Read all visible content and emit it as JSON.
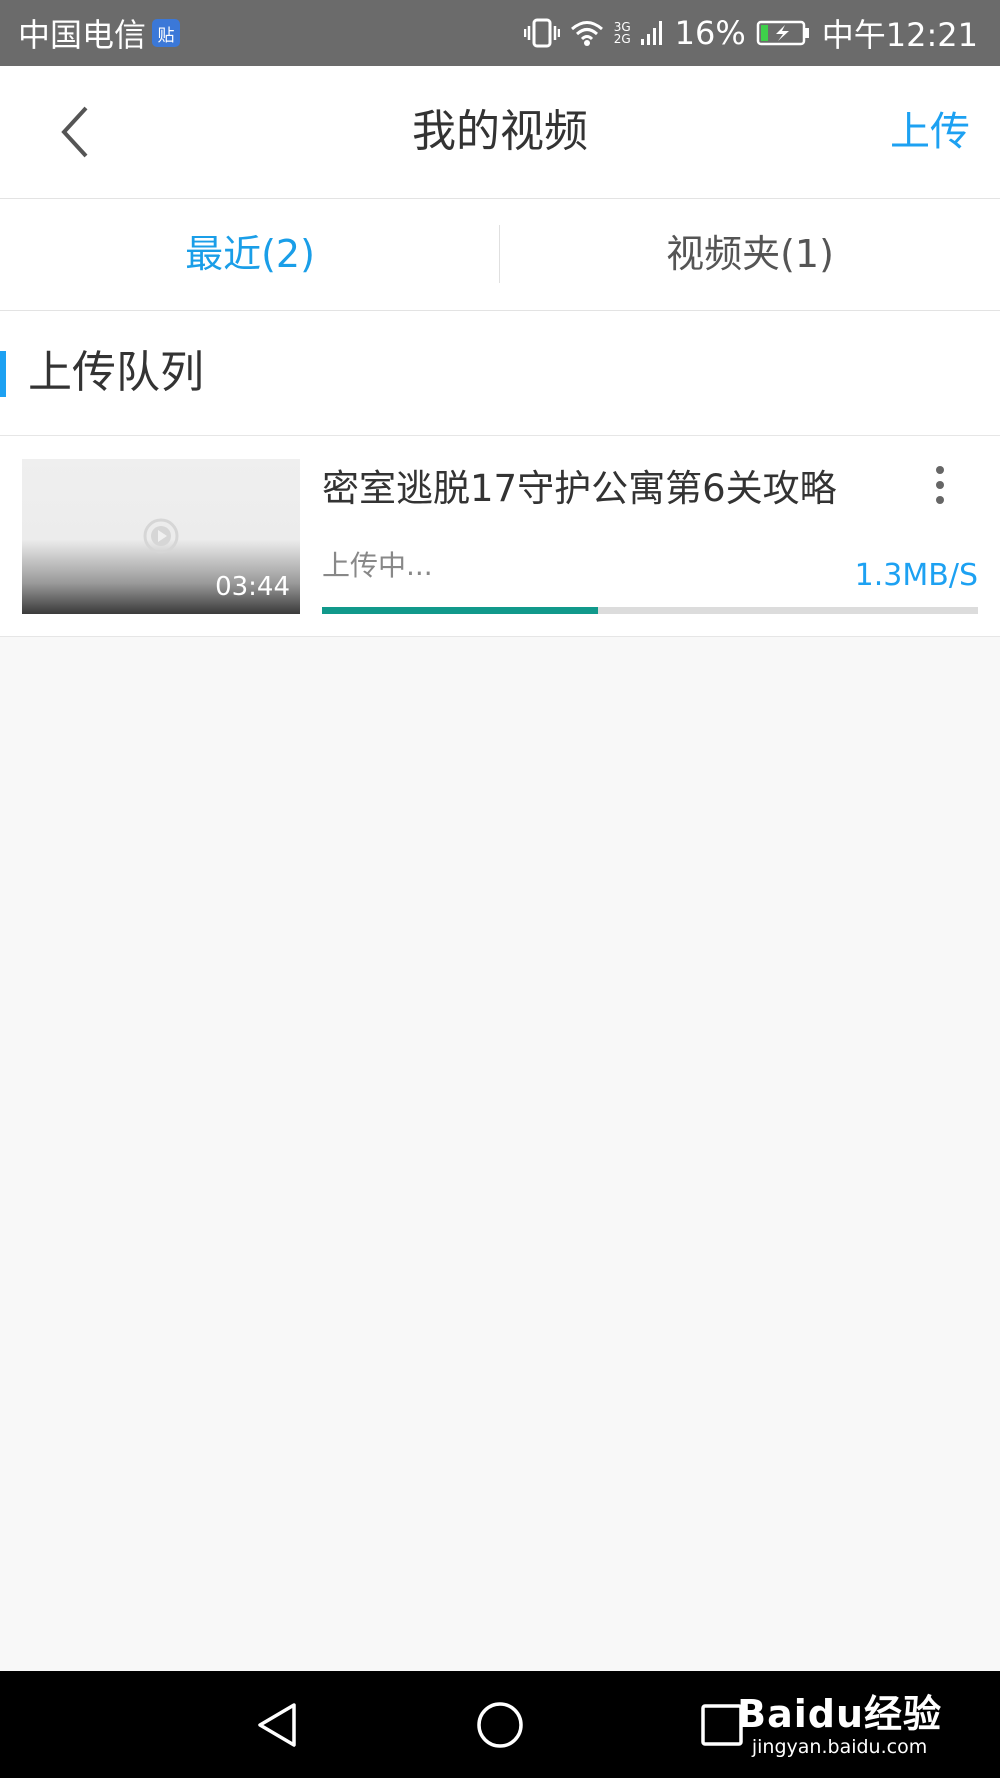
{
  "status_bar": {
    "carrier": "中国电信",
    "tieba_badge": "贴",
    "network_top": "3G",
    "network_bottom": "2G",
    "battery": "16%",
    "time": "中午12:21"
  },
  "header": {
    "title": "我的视频",
    "upload_label": "上传",
    "back_icon": "chevron-left-icon"
  },
  "tabs": [
    {
      "label": "最近(2)",
      "active": true
    },
    {
      "label": "视频夹(1)",
      "active": false
    }
  ],
  "section": {
    "title": "上传队列"
  },
  "upload_item": {
    "title": "密室逃脱17守护公寓第6关攻略",
    "duration": "03:44",
    "status": "上传中...",
    "speed": "1.3MB/S",
    "progress": 0.42
  },
  "watermark": {
    "line1": "Baidu经验",
    "line2": "jingyan.baidu.com"
  },
  "colors": {
    "accent": "#1da1f2",
    "progress": "#11998b",
    "status_bar": "#6b6b6b"
  }
}
